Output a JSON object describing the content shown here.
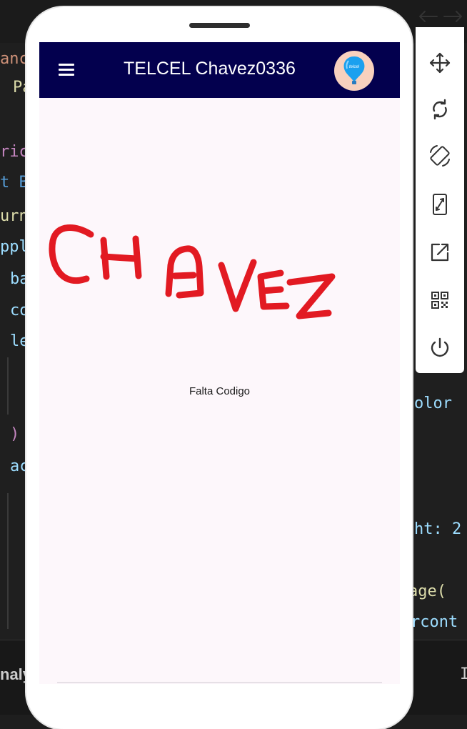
{
  "editor": {
    "left_fragments": [
      "anc",
      "Pa",
      "ric",
      "t B",
      "urn",
      "ppl",
      "ba",
      "co",
      "le",
      ")",
      "ac",
      "nalyt"
    ],
    "right_fragments": [
      "olor",
      "ht: 2",
      "age(",
      "rcont",
      "I"
    ]
  },
  "app": {
    "title": "TELCEL Chavez0336",
    "avatar_icon": "balloon-icon",
    "signature_text": "CHAVEZ",
    "message": "Falta Codigo",
    "colors": {
      "appbar": "#03004e",
      "background": "#fdf7fb",
      "signature": "#e21a22"
    }
  },
  "toolbar": {
    "tools": [
      "resize-arrows-icon",
      "move-icon",
      "rotate-icon",
      "screen-rotate-icon",
      "resize-icon",
      "open-external-icon",
      "qr-code-icon",
      "power-icon"
    ]
  }
}
